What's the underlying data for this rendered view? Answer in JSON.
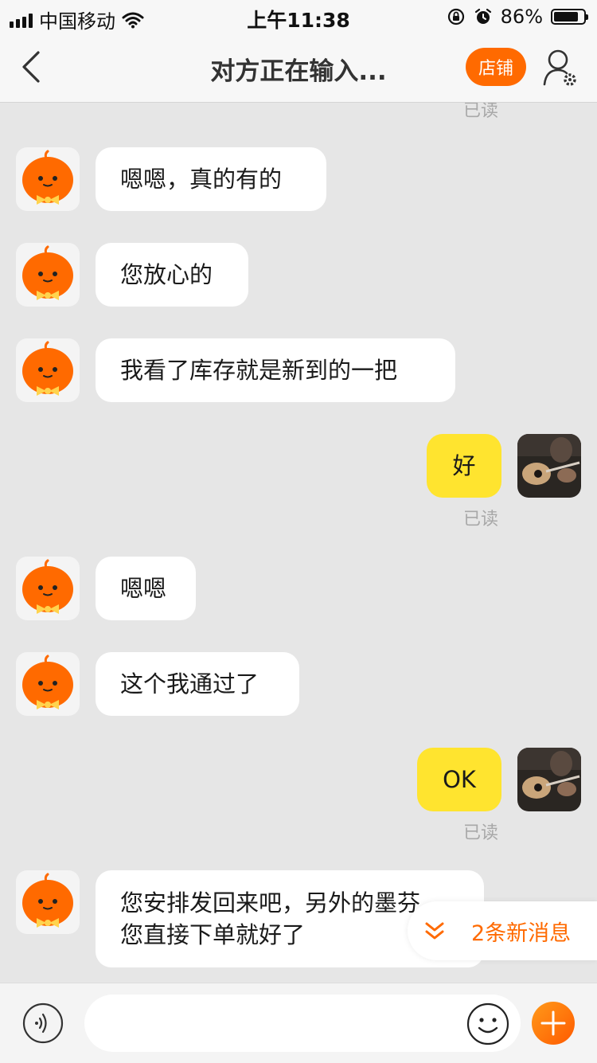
{
  "status_bar": {
    "carrier": "中国移动",
    "time": "上午11:38",
    "battery_percent": "86%",
    "battery_level": 0.86
  },
  "nav": {
    "title": "对方正在输入...",
    "shop_label": "店铺"
  },
  "messages": [
    {
      "sender": "seller",
      "text": "嗯嗯，真的有的"
    },
    {
      "sender": "seller",
      "text": "您放心的"
    },
    {
      "sender": "seller",
      "text": "我看了库存就是新到的一把"
    },
    {
      "sender": "user",
      "text": "好",
      "read": "已读"
    },
    {
      "sender": "seller",
      "text": "嗯嗯"
    },
    {
      "sender": "seller",
      "text": "这个我通过了"
    },
    {
      "sender": "user",
      "text": "OK",
      "read": "已读"
    },
    {
      "sender": "seller",
      "text_line1": "您安排发回来吧，另外的墨芬",
      "text_line2": "您直接下单就好了"
    }
  ],
  "top_read_receipt": "已读",
  "new_messages": "2条新消息",
  "input": {
    "placeholder": ""
  },
  "colors": {
    "accent": "#ff6a00",
    "user_bubble": "#ffe42f",
    "seller_bubble": "#ffffff",
    "chat_background": "#e6e6e6"
  },
  "icons": [
    "back-chevron-icon",
    "wifi-icon",
    "lock-rotation-icon",
    "alarm-icon",
    "battery-icon",
    "profile-settings-icon",
    "voice-icon",
    "emoji-icon",
    "plus-icon",
    "double-chevron-down-icon"
  ]
}
